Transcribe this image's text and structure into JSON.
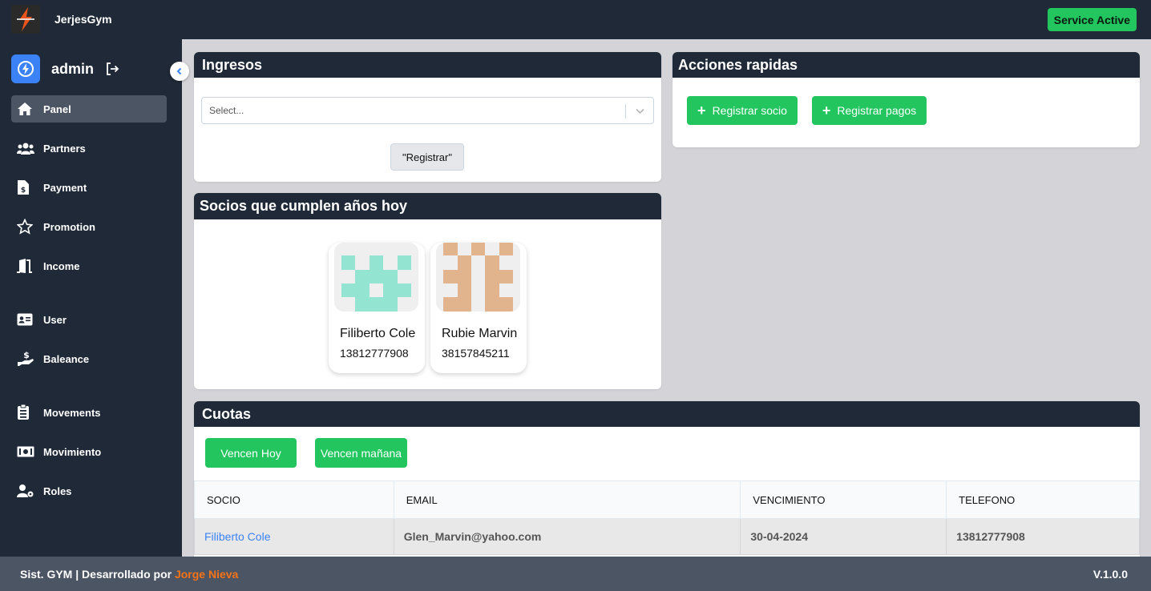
{
  "app": {
    "name": "JerjesGym",
    "service_status": "Service Active"
  },
  "user": {
    "name": "admin"
  },
  "sidebar": {
    "items": [
      {
        "label": "Panel",
        "icon": "home-icon",
        "active": true
      },
      {
        "label": "Partners",
        "icon": "users-icon"
      },
      {
        "label": "Payment",
        "icon": "invoice-dollar-icon"
      },
      {
        "label": "Promotion",
        "icon": "star-icon"
      },
      {
        "label": "Income",
        "icon": "door-open-icon"
      },
      {
        "label": "User",
        "icon": "id-card-icon"
      },
      {
        "label": "Baleance",
        "icon": "hand-dollar-icon"
      },
      {
        "label": "Movements",
        "icon": "clipboard-list-icon"
      },
      {
        "label": "Movimiento",
        "icon": "money-bill-icon"
      },
      {
        "label": "Roles",
        "icon": "user-gear-icon"
      }
    ]
  },
  "ingresos": {
    "title": "Ingresos",
    "select_placeholder": "Select...",
    "button": "\"Registrar\""
  },
  "acciones": {
    "title": "Acciones rapidas",
    "register_partner": "Registrar socio",
    "register_payment": "Registrar pagos"
  },
  "birthdays": {
    "title": "Socios que cumplen años hoy",
    "people": [
      {
        "name": "Filiberto Cole",
        "phone": "13812777908",
        "avatar_color": "#93e5d1"
      },
      {
        "name": "Rubie Marvin",
        "phone": "38157845211",
        "avatar_color": "#e2b48e"
      }
    ]
  },
  "cuotas": {
    "title": "Cuotas",
    "btn_today": "Vencen Hoy",
    "btn_tomorrow": "Vencen mañana",
    "columns": [
      "SOCIO",
      "EMAIL",
      "VENCIMIENTO",
      "TELEFONO"
    ],
    "rows": [
      {
        "socio": "Filiberto Cole",
        "email": "Glen_Marvin@yahoo.com",
        "vencimiento": "30-04-2024",
        "telefono": "13812777908"
      }
    ]
  },
  "footer": {
    "prefix": "Sist. GYM | Desarrollado por ",
    "author": "Jorge Nieva",
    "version": "V.1.0.0"
  },
  "colors": {
    "dark": "#1f2937",
    "green": "#22c55e",
    "blue": "#3b82f6",
    "orange": "#f97316"
  }
}
